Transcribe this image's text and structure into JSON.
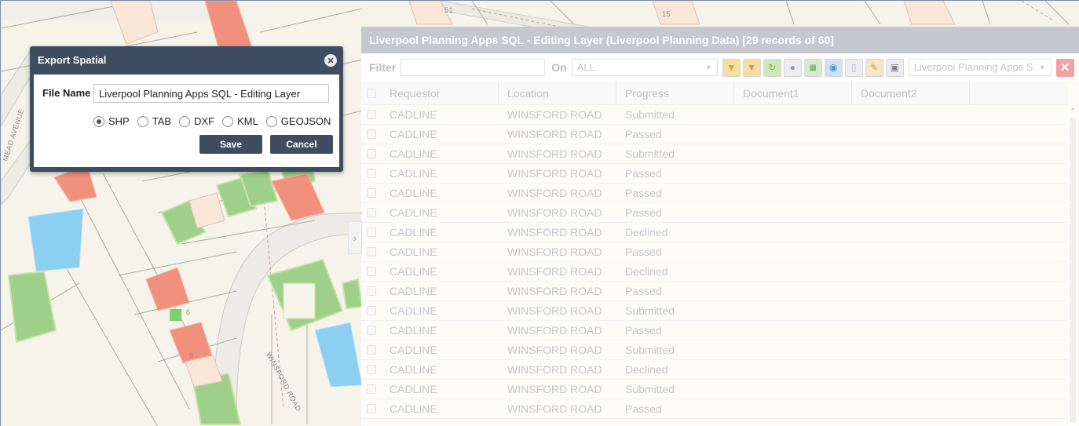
{
  "map": {
    "road_labels": [
      "WINSFORD ROAD",
      "MEAD AVENUE"
    ],
    "plot_numbers": [
      "6",
      "9",
      "15",
      "51"
    ]
  },
  "colors": {
    "dialog_header": "#3e4d60",
    "grid_title_bar": "#c5c8ce",
    "map_background": "#f6f4ea",
    "plot_green": "#9ed08a",
    "plot_red": "#f2907e",
    "plot_blue": "#8ccff0"
  },
  "grid": {
    "title": "Liverpool Planning Apps SQL - Editing Layer (Liverpool Planning Data) [29 records of 60]",
    "toolbar": {
      "filter_label": "Filter",
      "filter_value": "",
      "on_label": "On",
      "on_value": "ALL",
      "layer_value": "Liverpool Planning Apps S"
    },
    "columns": [
      "Requestor",
      "Location",
      "Progress",
      "Document1",
      "Document2"
    ],
    "rows": [
      [
        "CADLINE",
        "WINSFORD ROAD",
        "Submitted",
        "",
        ""
      ],
      [
        "CADLINE",
        "WINSFORD ROAD",
        "Passed",
        "",
        ""
      ],
      [
        "CADLINE",
        "WINSFORD ROAD",
        "Submitted",
        "",
        ""
      ],
      [
        "CADLINE",
        "WINSFORD ROAD",
        "Passed",
        "",
        ""
      ],
      [
        "CADLINE",
        "WINSFORD ROAD",
        "Passed",
        "",
        ""
      ],
      [
        "CADLINE",
        "WINSFORD ROAD",
        "Passed",
        "",
        ""
      ],
      [
        "CADLINE",
        "WINSFORD ROAD",
        "Declined",
        "",
        ""
      ],
      [
        "CADLINE",
        "WINSFORD ROAD",
        "Passed",
        "",
        ""
      ],
      [
        "CADLINE",
        "WINSFORD ROAD",
        "Declined",
        "",
        ""
      ],
      [
        "CADLINE",
        "WINSFORD ROAD",
        "Passed",
        "",
        ""
      ],
      [
        "CADLINE",
        "WINSFORD ROAD",
        "Submitted",
        "",
        ""
      ],
      [
        "CADLINE",
        "WINSFORD ROAD",
        "Passed",
        "",
        ""
      ],
      [
        "CADLINE",
        "WINSFORD ROAD",
        "Submitted",
        "",
        ""
      ],
      [
        "CADLINE",
        "WINSFORD ROAD",
        "Declined",
        "",
        ""
      ],
      [
        "CADLINE",
        "WINSFORD ROAD",
        "Submitted",
        "",
        ""
      ],
      [
        "CADLINE",
        "WINSFORD ROAD",
        "Passed",
        "",
        ""
      ]
    ],
    "toolbar_icons": [
      "filter-icon",
      "clear-filter-icon",
      "refresh-icon",
      "zoom-to-icon",
      "export-excel-icon",
      "globe-icon",
      "document-icon",
      "edit-icon",
      "save-icon"
    ]
  },
  "dialog": {
    "title": "Export Spatial",
    "filename_label": "File Name",
    "filename_value": "Liverpool Planning Apps SQL - Editing Layer",
    "formats": [
      "SHP",
      "TAB",
      "DXF",
      "KML",
      "GEOJSON"
    ],
    "selected_format": "SHP",
    "save_label": "Save",
    "cancel_label": "Cancel"
  }
}
